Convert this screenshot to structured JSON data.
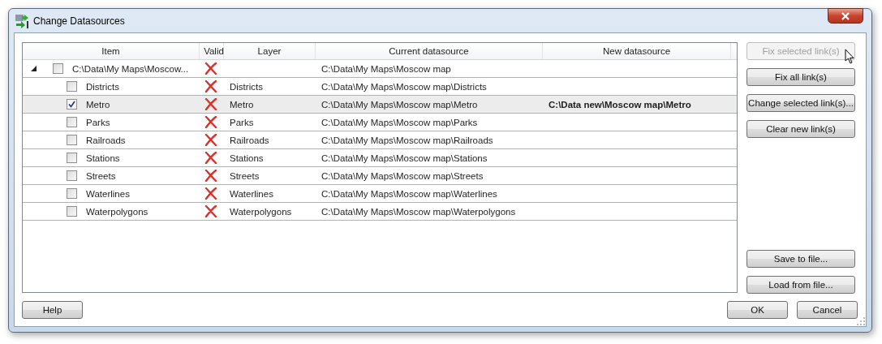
{
  "window": {
    "title": "Change Datasources"
  },
  "table": {
    "columns": [
      "Item",
      "Valid",
      "Layer",
      "Current datasource",
      "New datasource"
    ],
    "rows": [
      {
        "item": "C:\\Data\\My Maps\\Moscow...",
        "valid": false,
        "current": "C:\\Data\\My Maps\\Moscow map",
        "checked": false,
        "selected": false,
        "expanded": true,
        "children": [
          {
            "item": "Districts",
            "valid": false,
            "layer": "Districts",
            "current": "C:\\Data\\My Maps\\Moscow map\\Districts",
            "checked": false,
            "selected": false
          },
          {
            "item": "Metro",
            "valid": false,
            "layer": "Metro",
            "current": "C:\\Data\\My Maps\\Moscow map\\Metro",
            "new": "C:\\Data new\\Moscow map\\Metro",
            "checked": true,
            "selected": true
          },
          {
            "item": "Parks",
            "valid": false,
            "layer": "Parks",
            "current": "C:\\Data\\My Maps\\Moscow map\\Parks",
            "checked": false,
            "selected": false
          },
          {
            "item": "Railroads",
            "valid": false,
            "layer": "Railroads",
            "current": "C:\\Data\\My Maps\\Moscow map\\Railroads",
            "checked": false,
            "selected": false
          },
          {
            "item": "Stations",
            "valid": false,
            "layer": "Stations",
            "current": "C:\\Data\\My Maps\\Moscow map\\Stations",
            "checked": false,
            "selected": false
          },
          {
            "item": "Streets",
            "valid": false,
            "layer": "Streets",
            "current": "C:\\Data\\My Maps\\Moscow map\\Streets",
            "checked": false,
            "selected": false
          },
          {
            "item": "Waterlines",
            "valid": false,
            "layer": "Waterlines",
            "current": "C:\\Data\\My Maps\\Moscow map\\Waterlines",
            "checked": false,
            "selected": false
          },
          {
            "item": "Waterpolygons",
            "valid": false,
            "layer": "Waterpolygons",
            "current": "C:\\Data\\My Maps\\Moscow map\\Waterpolygons",
            "checked": false,
            "selected": false
          }
        ]
      }
    ]
  },
  "side_buttons": [
    {
      "label": "Fix selected link(s)",
      "disabled": true
    },
    {
      "label": "Fix all link(s)",
      "disabled": false
    },
    {
      "label": "Change selected link(s)...",
      "disabled": false
    },
    {
      "label": "Clear new link(s)",
      "disabled": false
    }
  ],
  "file_buttons": [
    {
      "label": "Save to file...",
      "disabled": false
    },
    {
      "label": "Load from file...",
      "disabled": false
    }
  ],
  "footer": {
    "help": "Help",
    "ok": "OK",
    "cancel": "Cancel"
  }
}
